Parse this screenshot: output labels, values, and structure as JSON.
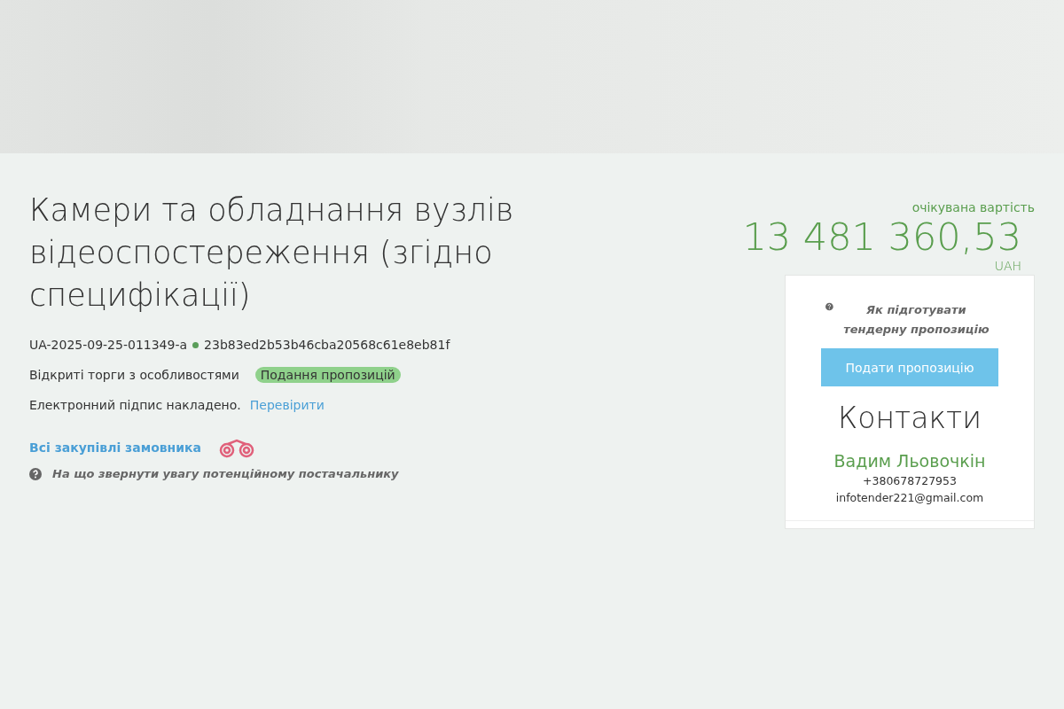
{
  "tender": {
    "title": "Камери та обладнання вузлів відеоспостереження (згідно специфікації)",
    "tender_id": "UA-2025-09-25-011349-a",
    "hash": "23b83ed2b53b46cba20568c61e8eb81f",
    "procedure": "Відкриті торги з особливостями",
    "status": "Подання пропозицій",
    "signature_text": "Електронний підпис накладено.",
    "signature_link": "Перевірити",
    "customer_link": "Всі закупівлі замовника",
    "supplier_hint": "На що звернути увагу потенційному постачальнику"
  },
  "price": {
    "label": "очікувана вартість",
    "amount": "13 481 360,53",
    "currency": "UAH"
  },
  "card": {
    "help_link": "Як підготувати тендерну пропозицію",
    "submit_button": "Подати пропозицію",
    "contacts_title": "Контакти",
    "contact_name": "Вадим Льовочкін",
    "phone": "+380678727953",
    "email": "infotender221@gmail.com"
  }
}
